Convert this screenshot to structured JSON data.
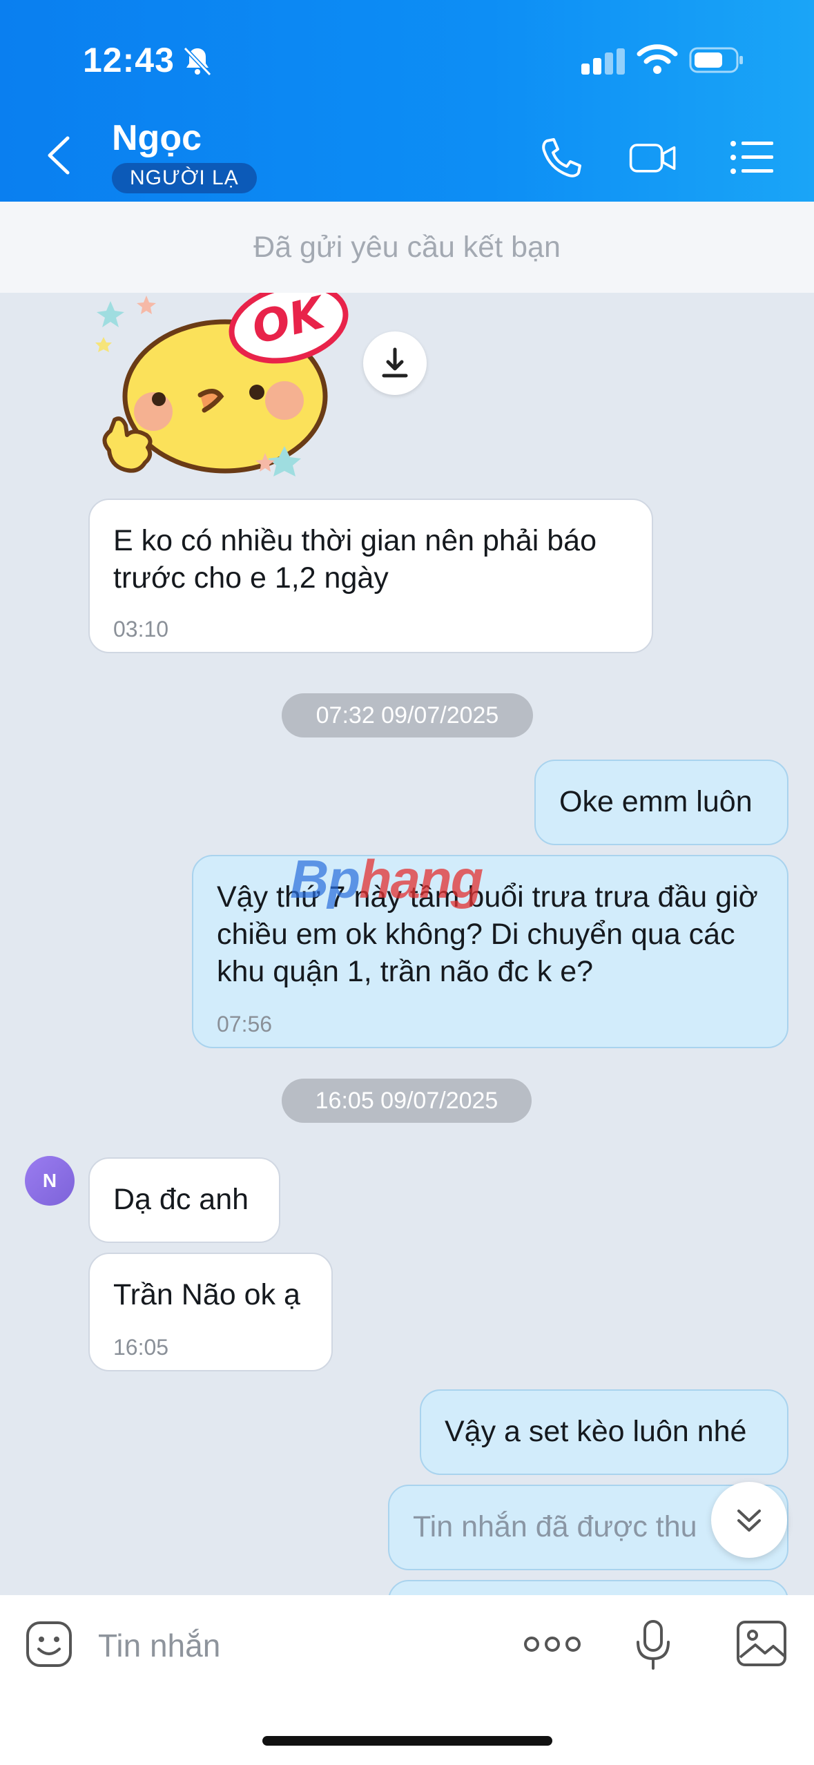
{
  "status_bar": {
    "time": "12:43"
  },
  "header": {
    "contact_name": "Ngọc",
    "badge": "NGƯỜI LẠ"
  },
  "banner": {
    "text": "Đã gửi yêu cầu kết bạn"
  },
  "sticker": {
    "label": "OK"
  },
  "watermark": {
    "part1": "Bp",
    "part2": "hang"
  },
  "messages": [
    {
      "direction": "in",
      "text": "E ko có nhiều thời gian nên phải báo trước cho e 1,2 ngày",
      "time": "03:10"
    },
    {
      "direction": "date",
      "text": "07:32 09/07/2025"
    },
    {
      "direction": "out",
      "text": "Oke emm luôn"
    },
    {
      "direction": "out",
      "text": "Vậy thứ 7 này tầm buổi trưa trưa đầu giờ chiều em ok không? Di chuyển qua các khu quận 1, trần não đc k e?",
      "time": "07:56"
    },
    {
      "direction": "date",
      "text": "16:05 09/07/2025"
    },
    {
      "direction": "in",
      "text": "Dạ đc anh",
      "avatar": "N"
    },
    {
      "direction": "in",
      "text": "Trần Não ok ạ",
      "time": "16:05"
    },
    {
      "direction": "out",
      "text": "Vậy a set kèo luôn nhé"
    },
    {
      "direction": "out",
      "text": "Tin nhắn đã được thu"
    }
  ],
  "composer": {
    "placeholder": "Tin nhắn"
  }
}
